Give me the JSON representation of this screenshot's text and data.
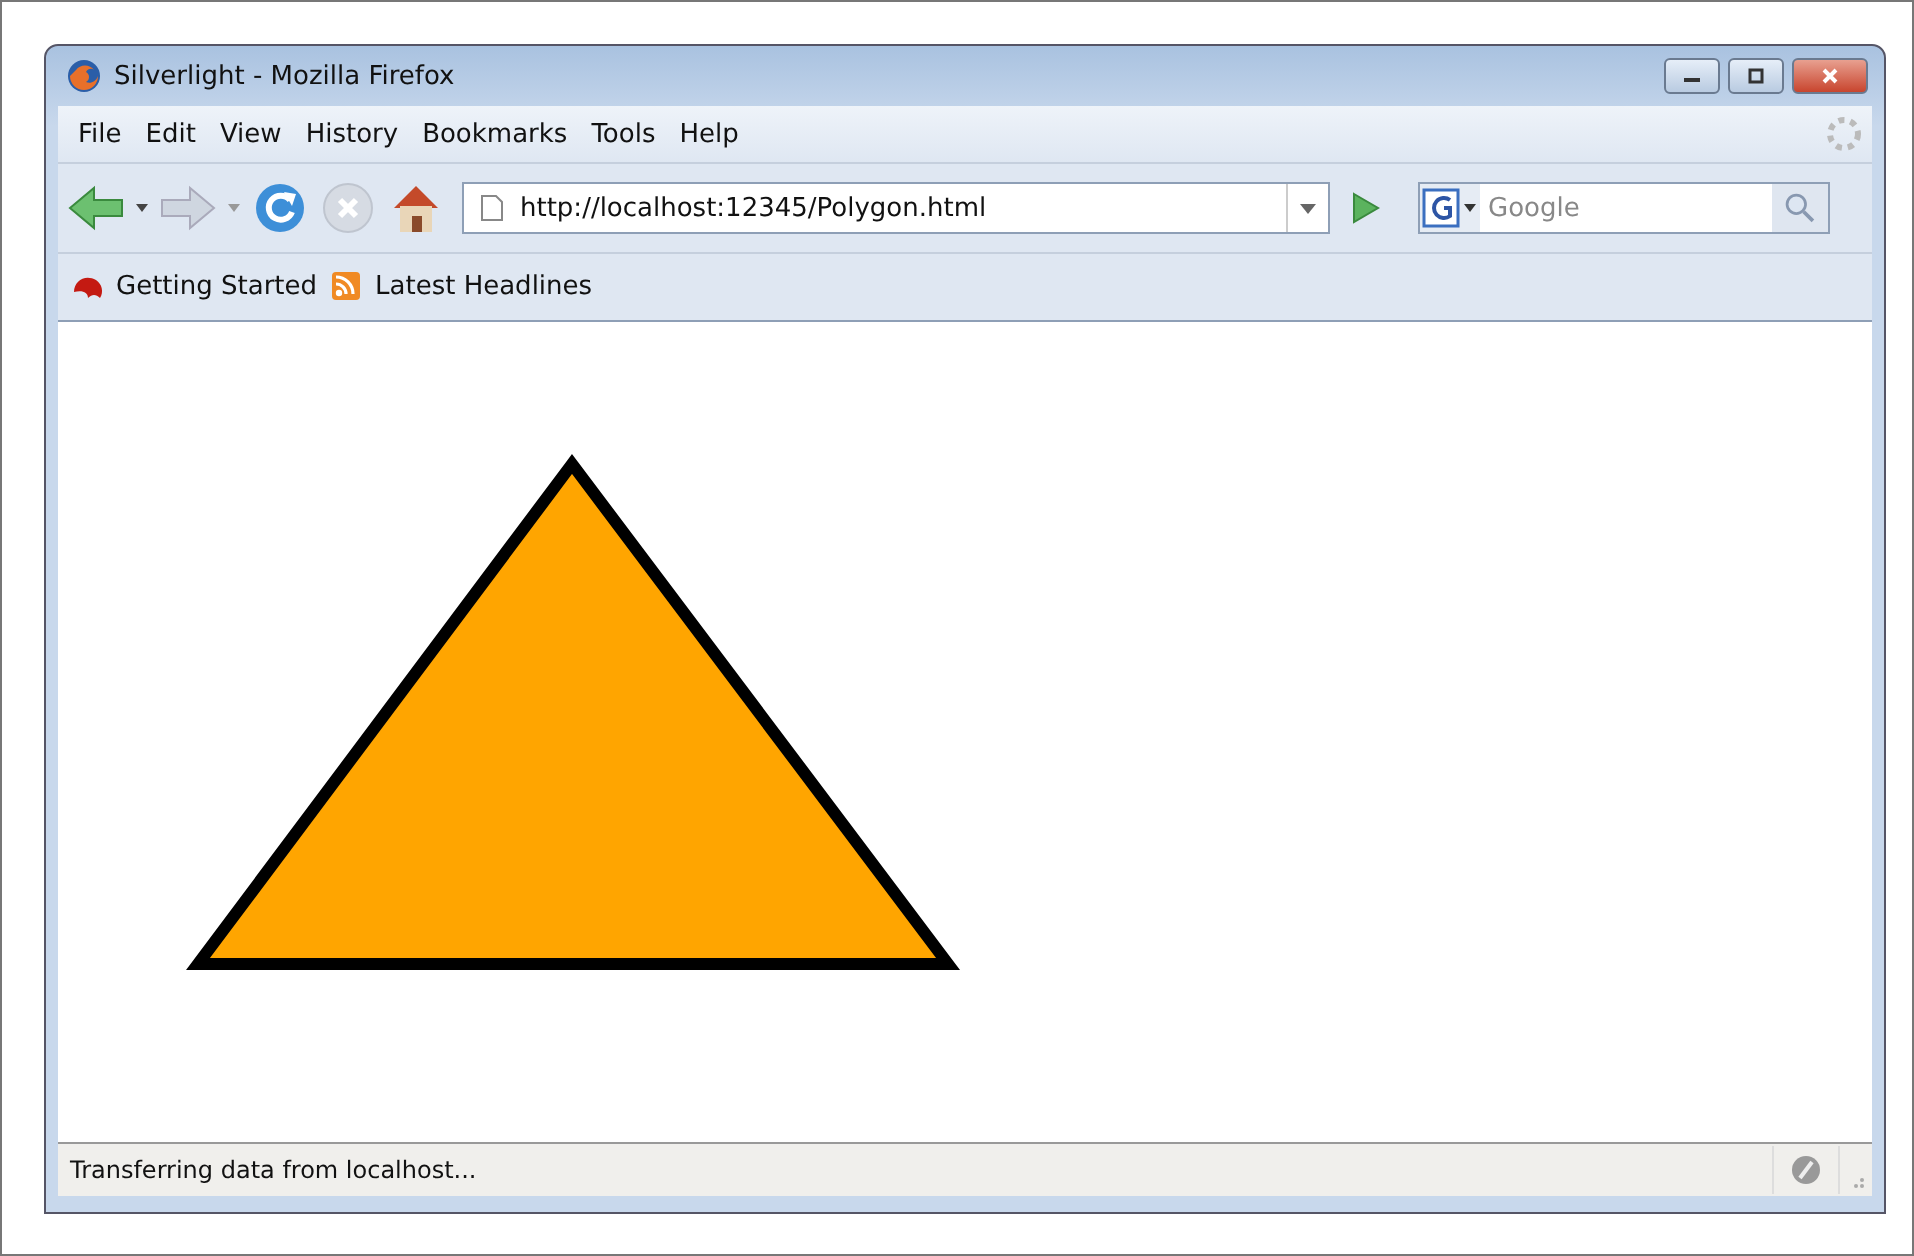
{
  "window": {
    "title": "Silverlight - Mozilla Firefox"
  },
  "menu": [
    "File",
    "Edit",
    "View",
    "History",
    "Bookmarks",
    "Tools",
    "Help"
  ],
  "toolbar": {
    "url": "http://localhost:12345/Polygon.html",
    "search": {
      "placeholder": "Google"
    }
  },
  "bookmarks": [
    {
      "label": "Getting Started",
      "kind": "getting-started"
    },
    {
      "label": "Latest Headlines",
      "kind": "feed"
    }
  ],
  "content": {
    "shape": {
      "kind": "polygon"
    }
  },
  "status_bar": {
    "text": "Transferring data from localhost..."
  }
}
